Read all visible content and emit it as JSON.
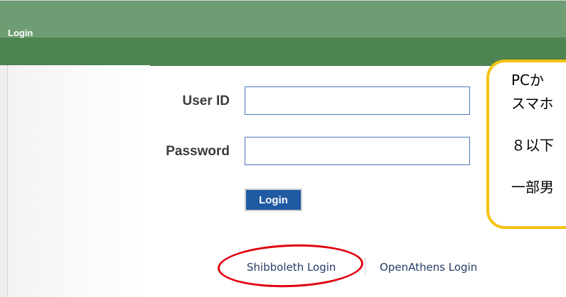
{
  "header": {
    "title": "Login"
  },
  "form": {
    "userid_label": "User ID",
    "userid_value": "",
    "password_label": "Password",
    "password_value": "",
    "login_button": "Login"
  },
  "links": {
    "shibboleth": "Shibboleth Login",
    "openathens": "OpenAthens Login"
  },
  "callout": {
    "lines": [
      "PCか",
      "スマホ",
      "８以下",
      "一部男"
    ]
  },
  "colors": {
    "header_light": "#6f9d73",
    "header_dark": "#4e8451",
    "button": "#1f5aa3",
    "highlight_oval": "#e0000e",
    "callout_border": "#f5c214"
  }
}
